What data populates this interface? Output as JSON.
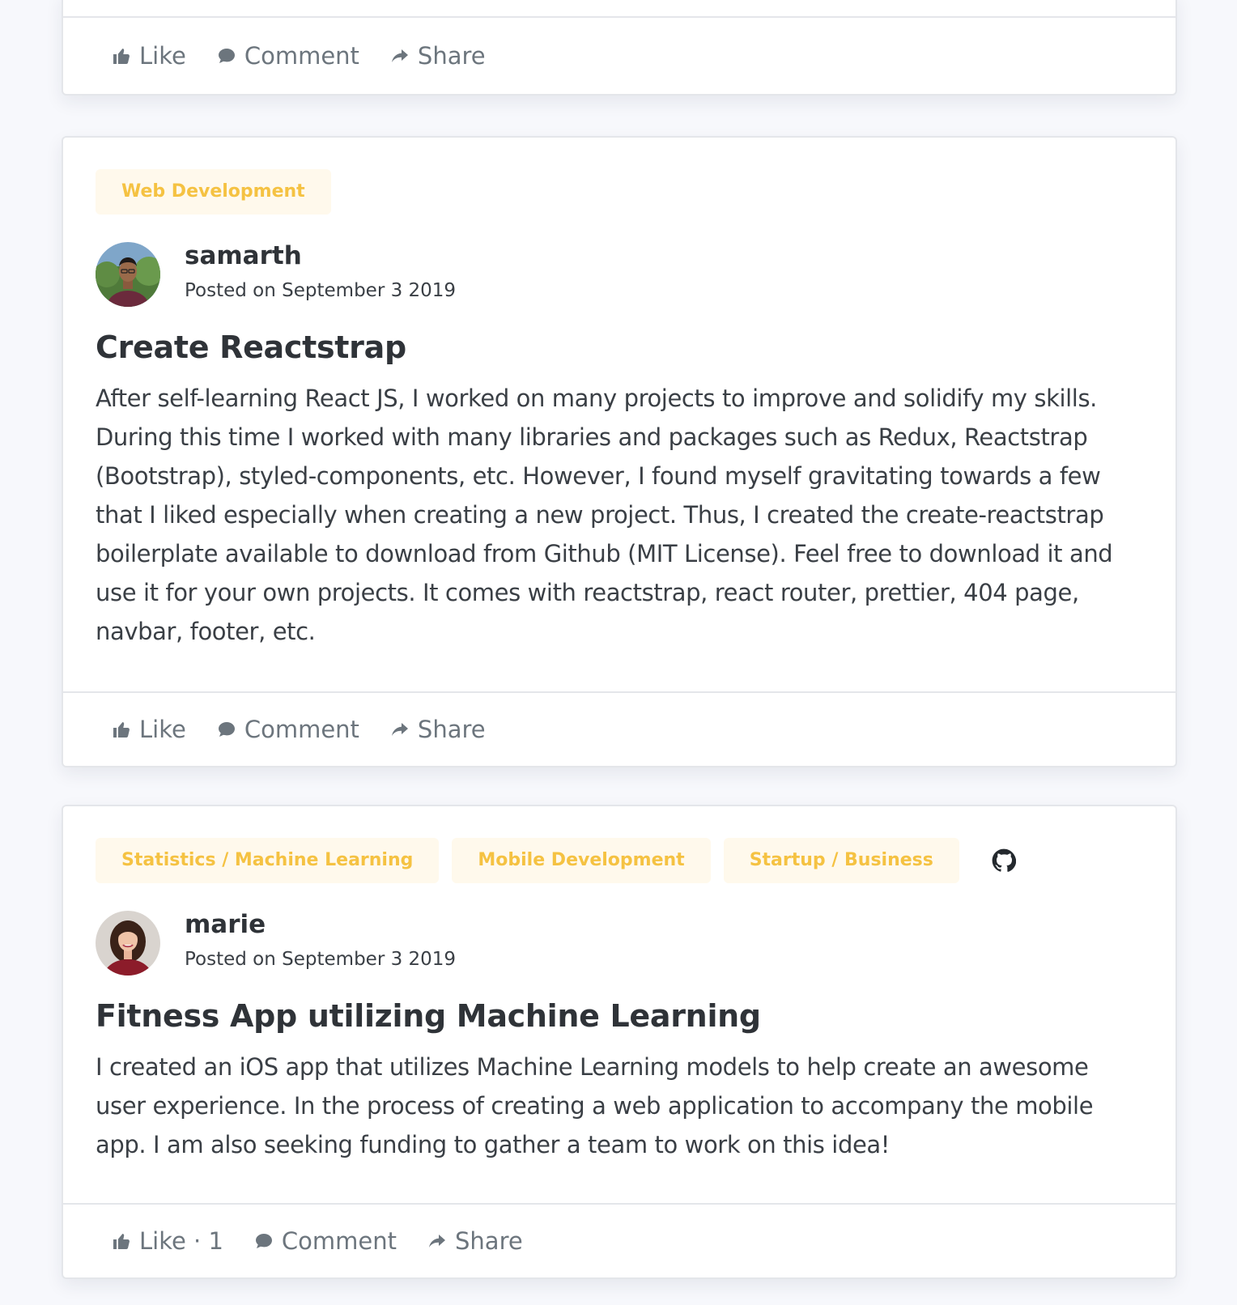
{
  "first_card": {
    "actions": {
      "like_label": "Like",
      "comment_label": "Comment",
      "share_label": "Share"
    }
  },
  "posts": [
    {
      "tags": [
        "Web Development"
      ],
      "author": "samarth",
      "posted": "Posted on September 3 2019",
      "title": "Create Reactstrap",
      "body": "After self-learning React JS, I worked on many projects to improve and solidify my skills. During this time I worked with many libraries and packages such as Redux, Reactstrap (Bootstrap), styled-components, etc. However, I found myself gravitating towards a few that I liked especially when creating a new project. Thus, I created the create-reactstrap boilerplate available to download from Github (MIT License). Feel free to download it and use it for your own projects. It comes with reactstrap, react router, prettier, 404 page, navbar, footer, etc.",
      "actions": {
        "like_label": "Like",
        "comment_label": "Comment",
        "share_label": "Share"
      }
    },
    {
      "tags": [
        "Statistics / Machine Learning",
        "Mobile Development",
        "Startup / Business"
      ],
      "github_icon": "github-icon",
      "author": "marie",
      "posted": "Posted on September 3 2019",
      "title": "Fitness App utilizing Machine Learning",
      "body": "I created an iOS app that utilizes Machine Learning models to help create an awesome user experience. In the process of creating a web application to accompany the mobile app. I am also seeking funding to gather a team to work on this idea!",
      "actions": {
        "like_label": "Like · 1",
        "comment_label": "Comment",
        "share_label": "Share"
      }
    }
  ],
  "colors": {
    "tag_text": "#f5c242",
    "tag_bg": "#fff9ec",
    "action": "#6c757d",
    "page_bg": "#f7f8fc"
  }
}
